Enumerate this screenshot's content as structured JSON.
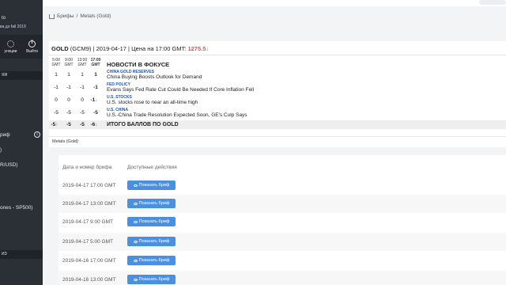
{
  "sidebar": {
    "user_line1": "to",
    "user_line2": "ва до fall 2019",
    "buttons": [
      {
        "label": "ункции",
        "icon": "gear-icon"
      },
      {
        "label": "Выйти",
        "icon": "power-icon"
      }
    ],
    "section1": "ЯЯ",
    "items": [
      {
        "label": "риф"
      },
      {
        "label": ")"
      },
      {
        "label": "R/USD)"
      },
      {
        "label": "ones - SP500)"
      }
    ],
    "section2": "ИЗ"
  },
  "breadcrumb": {
    "home_icon": "home-icon",
    "items": [
      "Брифы",
      "/",
      "Metals (Gold)"
    ]
  },
  "focus_card": {
    "symbol": "GOLD",
    "contract": "(GCM9)",
    "date": "2019-04-17",
    "price_label": "Цена на 17:00 GMT:",
    "price": "1275.5",
    "price_arrow": "↓",
    "colors": {
      "down": "#d9534f",
      "up": "#2e9d47",
      "category": "#2255aa"
    },
    "times": [
      "5:00 GMT",
      "9:00 GMT",
      "13:00 GMT",
      "17:00 GMT"
    ],
    "focus_title": "НОВОСТИ В ФОКУСЕ",
    "rows": [
      {
        "scores": [
          "1",
          "1",
          "1",
          "1"
        ],
        "arrow": "",
        "category": "CHINA GOLD RESERVES",
        "headline": "China Buying Boosts Outlook for Demand"
      },
      {
        "scores": [
          "-1",
          "-1",
          "-1",
          "-1"
        ],
        "arrow": "",
        "category": "FED POLICY",
        "headline": "Evans Says Fed Rate Cut Could Be Needed If Core Inflation Fell"
      },
      {
        "scores": [
          "0",
          "0",
          "0",
          "-1"
        ],
        "arrow": "↓",
        "category": "U.S. STOCKS",
        "headline": "U.S. stocks rose to near an all-time high"
      },
      {
        "scores": [
          "-5",
          "-5",
          "-5",
          "-5"
        ],
        "arrow": "",
        "category": "U.S. CHINA",
        "headline": "U.S.-China Trade Resolution Expected Soon, GE's Culp Says"
      }
    ],
    "total": {
      "scores": [
        "-5",
        "-5",
        "-5",
        "-6"
      ],
      "first_arrow": "↑",
      "last_arrow": "↓",
      "label": "ИТОГО БАЛЛОВ ПО GOLD"
    }
  },
  "metals": {
    "title": "Metals (Gold)",
    "columns": [
      "Дата и номер брифа",
      "Доступные действия"
    ],
    "button_label": "Показать бриф",
    "button_icon": "eye-icon",
    "button_color": "#4a90e2",
    "rows": [
      {
        "date": "2019-04-17 17:00 GMT"
      },
      {
        "date": "2019-04-17 13:00 GMT"
      },
      {
        "date": "2019-04-17 9:00 GMT"
      },
      {
        "date": "2019-04-17 5:00 GMT"
      },
      {
        "date": "2019-04-16 17:00 GMT"
      },
      {
        "date": "2019-04-16 13:00 GMT"
      }
    ]
  }
}
